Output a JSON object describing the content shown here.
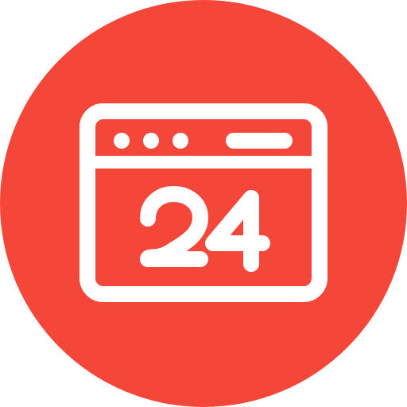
{
  "icon": {
    "name": "browser-window-24-icon",
    "number": "24"
  },
  "colors": {
    "circle": "#F4473A",
    "foreground": "#FFFFFF"
  }
}
